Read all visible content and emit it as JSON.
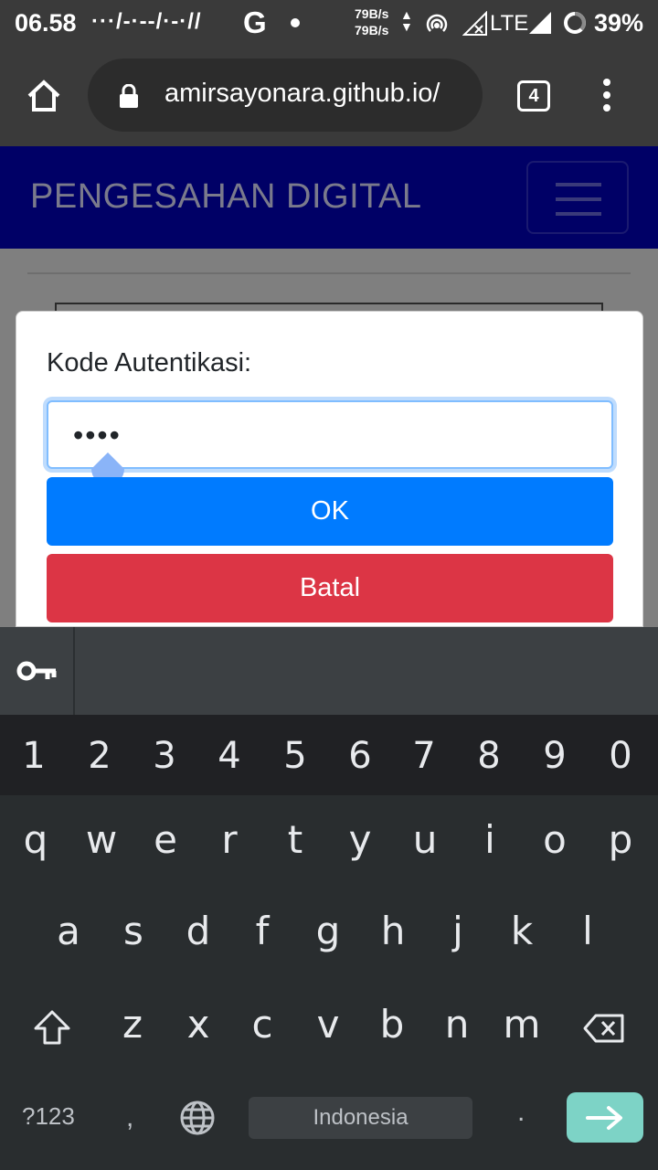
{
  "status_bar": {
    "time": "06.58",
    "notif_icons": "···/-·--/·-·//",
    "g_label": "G",
    "speed_up": "79B/s",
    "speed_down": "79B/s",
    "network_label": "LTE",
    "battery": "39%"
  },
  "browser": {
    "url": "amirsayonara.github.io/",
    "tab_count": "4"
  },
  "site": {
    "brand": "PENGESAHAN DIGITAL"
  },
  "dialog": {
    "label": "Kode Autentikasi:",
    "input_value": "••••",
    "ok_label": "OK",
    "cancel_label": "Batal"
  },
  "keyboard": {
    "numbers": [
      "1",
      "2",
      "3",
      "4",
      "5",
      "6",
      "7",
      "8",
      "9",
      "0"
    ],
    "row1": [
      "q",
      "w",
      "e",
      "r",
      "t",
      "y",
      "u",
      "i",
      "o",
      "p"
    ],
    "row2": [
      "a",
      "s",
      "d",
      "f",
      "g",
      "h",
      "j",
      "k",
      "l"
    ],
    "row3": [
      "z",
      "x",
      "c",
      "v",
      "b",
      "n",
      "m"
    ],
    "symbols_label": "?123",
    "comma": ",",
    "space_label": "Indonesia",
    "period": "."
  },
  "colors": {
    "navbar": "#000066",
    "ok_button": "#007bff",
    "cancel_button": "#dc3545",
    "enter_key": "#7dd3c6"
  }
}
